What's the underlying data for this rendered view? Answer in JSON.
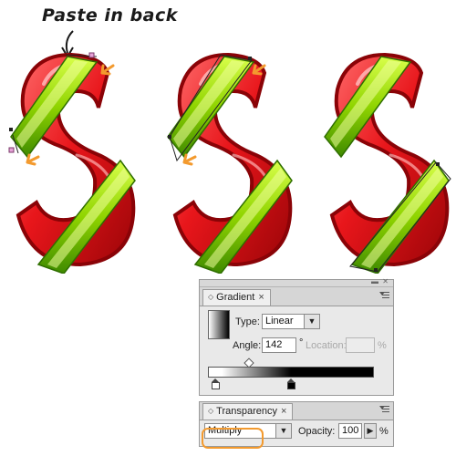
{
  "annotation": {
    "text": "Paste in back"
  },
  "colors": {
    "letter_red": "#e8161b",
    "ribbon_green": "#8fd400",
    "pointer_orange": "#f39a2e",
    "highlight_orange": "#f39a2e"
  },
  "gradient_panel": {
    "tab_label": "Gradient",
    "tab_close": "×",
    "type_label": "Type:",
    "type_value": "Linear",
    "angle_label": "Angle:",
    "angle_value": "142",
    "angle_unit": "°",
    "location_label": "Location:",
    "location_value": "",
    "location_unit": "%",
    "gradient": {
      "start_color": "#ffffff",
      "end_color": "#000000",
      "midpoint_percent": 25
    }
  },
  "transparency_panel": {
    "tab_label": "Transparency",
    "tab_close": "×",
    "blend_mode": "Multiply",
    "opacity_label": "Opacity:",
    "opacity_value": "100",
    "opacity_unit": "%"
  },
  "icons": [
    "panel-menu-icon",
    "dropdown-arrow-icon",
    "gradient-stop-icon",
    "midpoint-diamond-icon",
    "annotation-arrow-icon",
    "pointer-arrow-icon"
  ]
}
